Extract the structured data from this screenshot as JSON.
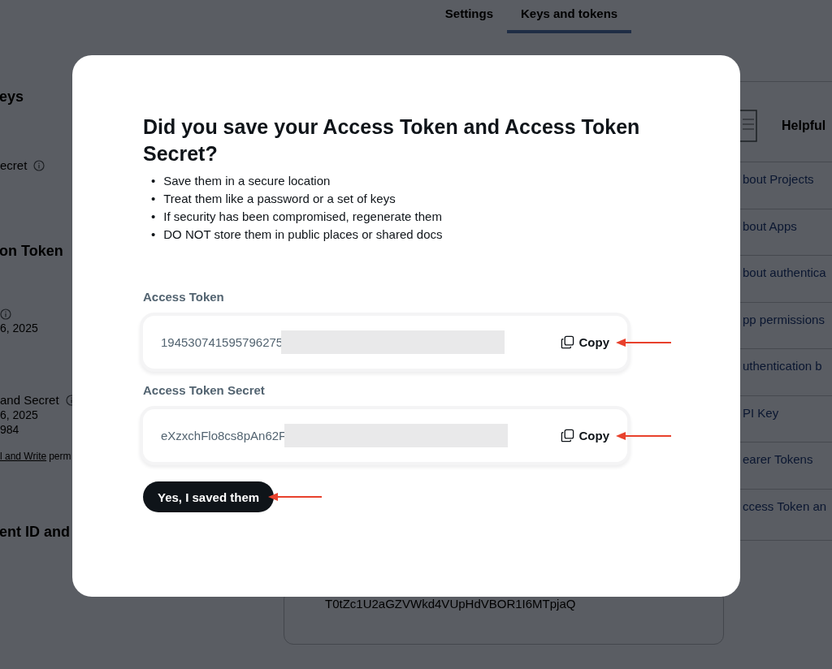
{
  "background_page": {
    "tabs": [
      {
        "label": "Settings",
        "selected": false
      },
      {
        "label": "Keys and tokens",
        "selected": true
      }
    ],
    "left_column": [
      {
        "kind": "heading",
        "text": "eys"
      },
      {
        "kind": "label",
        "text": "ecret",
        "info": true
      },
      {
        "kind": "heading",
        "text": "on Token"
      },
      {
        "kind": "info"
      },
      {
        "kind": "meta",
        "text": "6, 2025"
      },
      {
        "kind": "label",
        "text": "and Secret",
        "info": true
      },
      {
        "kind": "meta",
        "text": "6, 2025"
      },
      {
        "kind": "meta",
        "text": "984"
      },
      {
        "kind": "permission",
        "link": "l and Write",
        "text": "perm"
      },
      {
        "kind": "heading",
        "text": "ent ID and"
      }
    ],
    "token_preview": "T0tZc1U2aGZVWkd4VUpHdVBOR1I6MTpjaQ",
    "helpful_panel": {
      "title": "Helpful",
      "links": [
        "bout Projects",
        "bout Apps",
        "bout authentica",
        "pp permissions",
        "uthentication b",
        "PI Key",
        "earer Tokens",
        "ccess Token an"
      ]
    }
  },
  "dialog": {
    "title": "Did you save your Access Token and Access Token Secret?",
    "bullet_marker": "•",
    "bullets": [
      "Save them in a secure location",
      "Treat them like a password or a set of keys",
      "If security has been compromised, regenerate them",
      "DO NOT store them in public places or shared docs"
    ],
    "fields": [
      {
        "label": "Access Token",
        "value": "194530741595796275",
        "redacted": true,
        "copy_label": "Copy",
        "marked": true
      },
      {
        "label": "Access Token Secret",
        "value": "eXzxchFlo8cs8pAn62F",
        "redacted": true,
        "copy_label": "Copy",
        "marked": true
      }
    ],
    "confirm_button": {
      "label": "Yes, I saved them",
      "marked": true
    }
  }
}
